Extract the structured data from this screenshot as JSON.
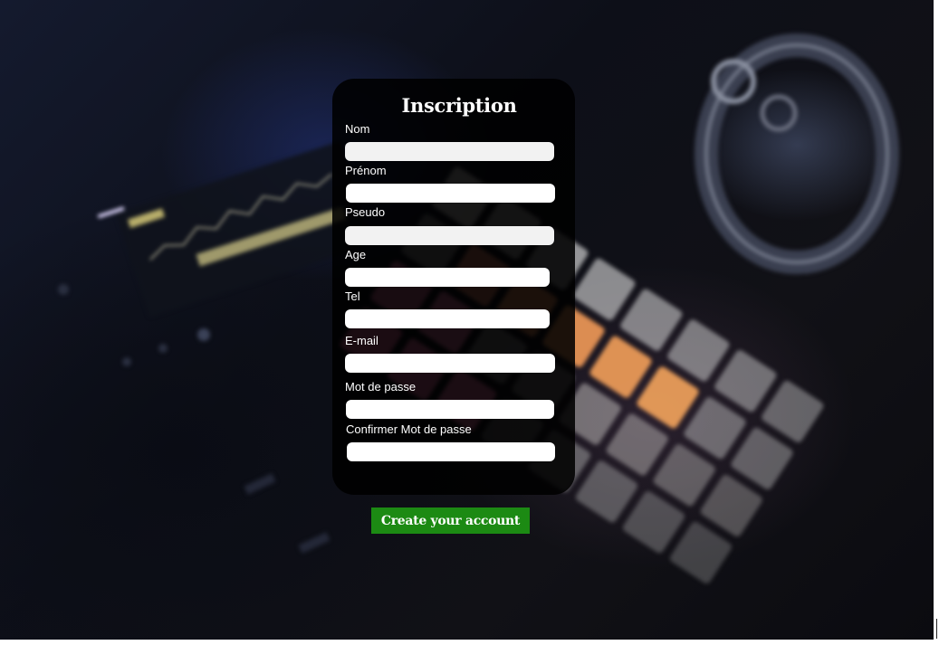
{
  "form": {
    "title": "Inscription",
    "fields": [
      {
        "label": "Nom",
        "value": ""
      },
      {
        "label": "Prénom",
        "value": ""
      },
      {
        "label": "Pseudo",
        "value": ""
      },
      {
        "label": "Age",
        "value": ""
      },
      {
        "label": "Tel",
        "value": ""
      },
      {
        "label": "E-mail",
        "value": ""
      },
      {
        "label": "Mot de passe",
        "value": ""
      },
      {
        "label": "Confirmer Mot de passe",
        "value": ""
      }
    ],
    "submit_label": "Create your account"
  },
  "colors": {
    "card_bg": "#000000",
    "submit_bg": "#1c8a13",
    "text": "#ffffff",
    "input_bg": "#f2f2f2"
  },
  "background": {
    "icon": "dj-controller-photo"
  }
}
